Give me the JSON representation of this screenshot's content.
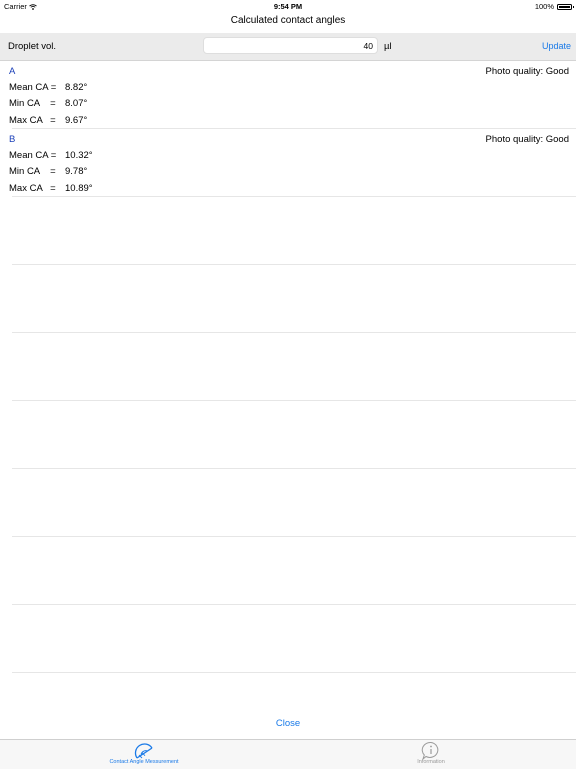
{
  "status_bar": {
    "carrier": "Carrier",
    "time": "9:54 PM",
    "battery": "100%",
    "battery_level": 1.0
  },
  "nav": {
    "title": "Calculated contact angles"
  },
  "toolbar": {
    "label": "Droplet vol.",
    "value": "40",
    "unit": "µl",
    "update_label": "Update"
  },
  "results": [
    {
      "id": "A",
      "quality": "Photo quality: Good",
      "mean_label": "Mean CA =",
      "mean": "8.82°",
      "min_label": "Min CA    =",
      "min": "8.07°",
      "max_label": "Max CA   =",
      "max": "9.67°"
    },
    {
      "id": "B",
      "quality": "Photo quality: Good",
      "mean_label": "Mean CA =",
      "mean": "10.32°",
      "min_label": "Min CA    =",
      "min": "9.78°",
      "max_label": "Max CA   =",
      "max": "10.89°"
    }
  ],
  "close_label": "Close",
  "tabs": [
    {
      "label": "Contact Angle Messurement",
      "icon": "protractor-icon",
      "color": "#1a7ae8",
      "active": true
    },
    {
      "label": "Information",
      "icon": "info-bubble-icon",
      "color": "#9a9a9a",
      "active": false
    }
  ],
  "colors": {
    "accent": "#1a7ae8",
    "row_label": "#1a3fb8",
    "toolbar_bg": "#ebebeb"
  }
}
